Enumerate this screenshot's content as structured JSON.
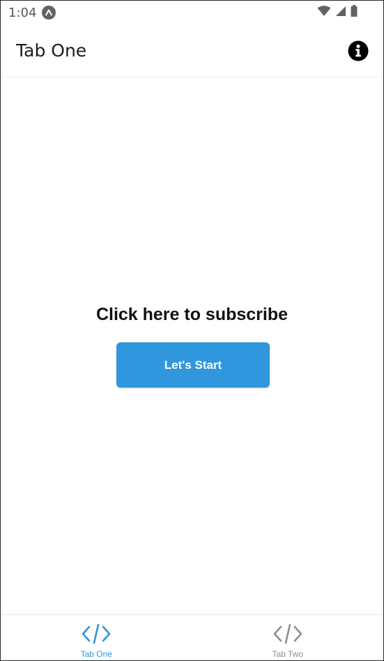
{
  "status_bar": {
    "time": "1:04"
  },
  "header": {
    "title": "Tab One",
    "info_icon": "info-circle-icon"
  },
  "main": {
    "heading": "Click here to subscribe",
    "button_label": "Let's Start"
  },
  "tabs": [
    {
      "label": "Tab One",
      "icon": "code-icon",
      "active": true
    },
    {
      "label": "Tab Two",
      "icon": "code-icon",
      "active": false
    }
  ],
  "colors": {
    "accent": "#3096dd",
    "active_tab": "#2f95dc",
    "inactive_tab": "#8e8e8e"
  }
}
